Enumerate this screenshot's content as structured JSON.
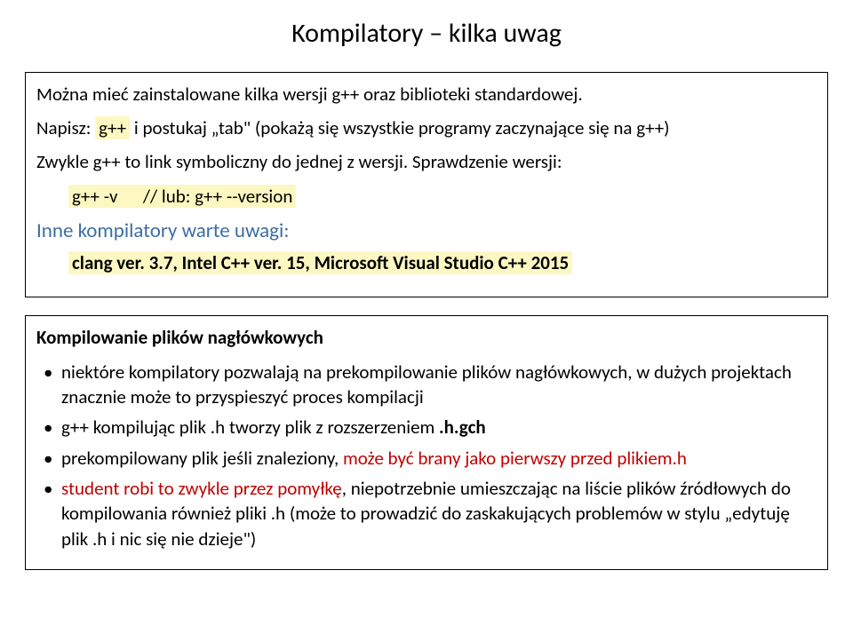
{
  "title": "Kompilatory – kilka uwag",
  "box1": {
    "line1_a": "Można mieć zainstalowane kilka wersji g++ oraz biblioteki standardowej.",
    "line2_prefix": "Napisz:",
    "line2_hl": "g++",
    "line2_suffix": " i postukaj „tab\" (pokażą się wszystkie programy zaczynające się na g++)",
    "line3": "Zwykle g++ to link symboliczny do jednej z wersji. Sprawdzenie wersji:",
    "line4_hl": "g++ -v      // lub: g++ --version",
    "sub": "Inne kompilatory warte uwagi:",
    "line5_hl": "clang ver. 3.7, Intel C++ ver. 15, Microsoft Visual Studio C++ 2015"
  },
  "box2": {
    "heading": "Kompilowanie plików nagłówkowych",
    "b1": "niektóre kompilatory pozwalają na prekompilowanie plików nagłówkowych, w dużych projektach znacznie może to przyspieszyć proces kompilacji",
    "b2_a": "g++ kompilując plik .h tworzy plik z rozszerzeniem ",
    "b2_b": ".h.gch",
    "b3_a": "prekompilowany plik jeśli znaleziony, ",
    "b3_b": "może być brany jako pierwszy przed plikiem.h",
    "b4_a": "student robi to zwykle przez pomyłkę",
    "b4_b": ", niepotrzebnie umieszczając na liście plików źródłowych do kompilowania również pliki .h (może to prowadzić do zaskakujących problemów w stylu „edytuję plik .h i nic się nie dzieje\")"
  }
}
